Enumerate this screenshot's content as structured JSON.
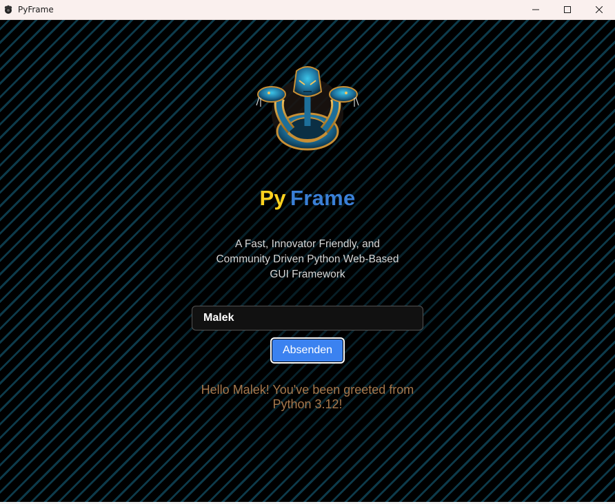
{
  "window": {
    "title": "PyFrame",
    "controls": {
      "minimize_icon": "minimize-icon",
      "maximize_icon": "maximize-icon",
      "close_icon": "close-icon"
    }
  },
  "brand": {
    "part1": "Py",
    "part2": "Frame",
    "part1_color": "#ffd21f",
    "part2_color": "#3a7fd6",
    "logo_icon": "three-headed-snake-logo"
  },
  "tagline": {
    "line1": "A Fast, Innovator Friendly, and",
    "line2": "Community Driven Python Web-Based",
    "line3": "GUI Framework"
  },
  "form": {
    "name_value": "Malek",
    "submit_label": "Absenden",
    "button_color": "#3b82f0"
  },
  "greeting": {
    "line1": "Hello Malek! You've been greeted from",
    "line2": "Python 3.12!",
    "color": "#a7784c"
  }
}
